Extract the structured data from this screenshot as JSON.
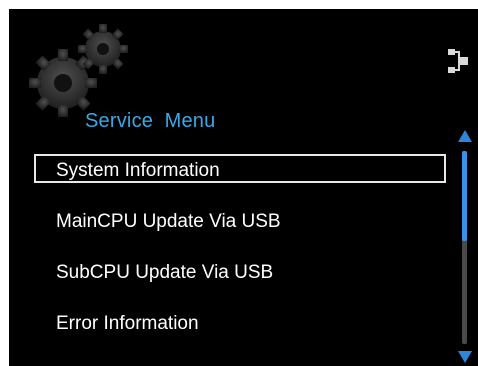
{
  "screen": {
    "title": "Service  Menu",
    "colors": {
      "background": "#000000",
      "title": "#3aa8e6",
      "text": "#ffffff",
      "scroll_accent": "#3a92e6",
      "selection_border": "#e8e8e8"
    },
    "icons": {
      "background_graphic": "gears-icon",
      "top_right": "network-icon",
      "scroll_up": "arrow-up-icon",
      "scroll_down": "arrow-down-icon"
    }
  },
  "menu": {
    "items": [
      {
        "label": "System Information",
        "selected": true
      },
      {
        "label": "MainCPU Update Via USB",
        "selected": false
      },
      {
        "label": "SubCPU Update Via USB",
        "selected": false
      },
      {
        "label": "Error Information",
        "selected": false
      }
    ]
  },
  "scrollbar": {
    "position": 0,
    "visible_fraction": 0.47
  }
}
